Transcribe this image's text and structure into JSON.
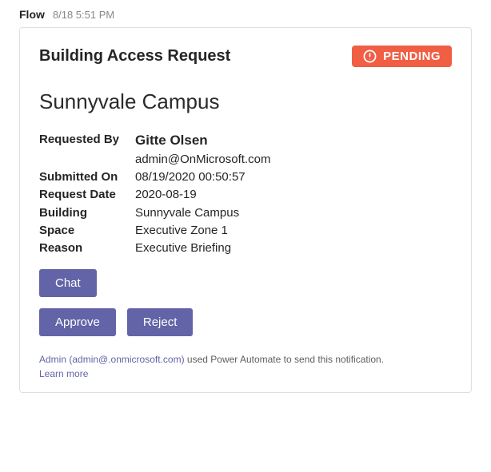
{
  "message": {
    "sender": "Flow",
    "timestamp": "8/18 5:51 PM"
  },
  "card": {
    "title": "Building Access Request",
    "status": "PENDING",
    "location": "Sunnyvale Campus",
    "labels": {
      "requested_by": "Requested By",
      "submitted_on": "Submitted On",
      "request_date": "Request Date",
      "building": "Building",
      "space": "Space",
      "reason": "Reason"
    },
    "values": {
      "requester_name": "Gitte Olsen",
      "requester_email": "admin@OnMicrosoft.com",
      "submitted_on": "08/19/2020 00:50:57",
      "request_date": "2020-08-19",
      "building": "Sunnyvale Campus",
      "space": "Executive Zone 1",
      "reason": "Executive Briefing"
    },
    "buttons": {
      "chat": "Chat",
      "approve": "Approve",
      "reject": "Reject"
    }
  },
  "footer": {
    "admin_text": "Admin (admin@.onmicrosoft.com)",
    "sent_text": " used Power Automate to send this notification.",
    "learn_more": "Learn more"
  }
}
